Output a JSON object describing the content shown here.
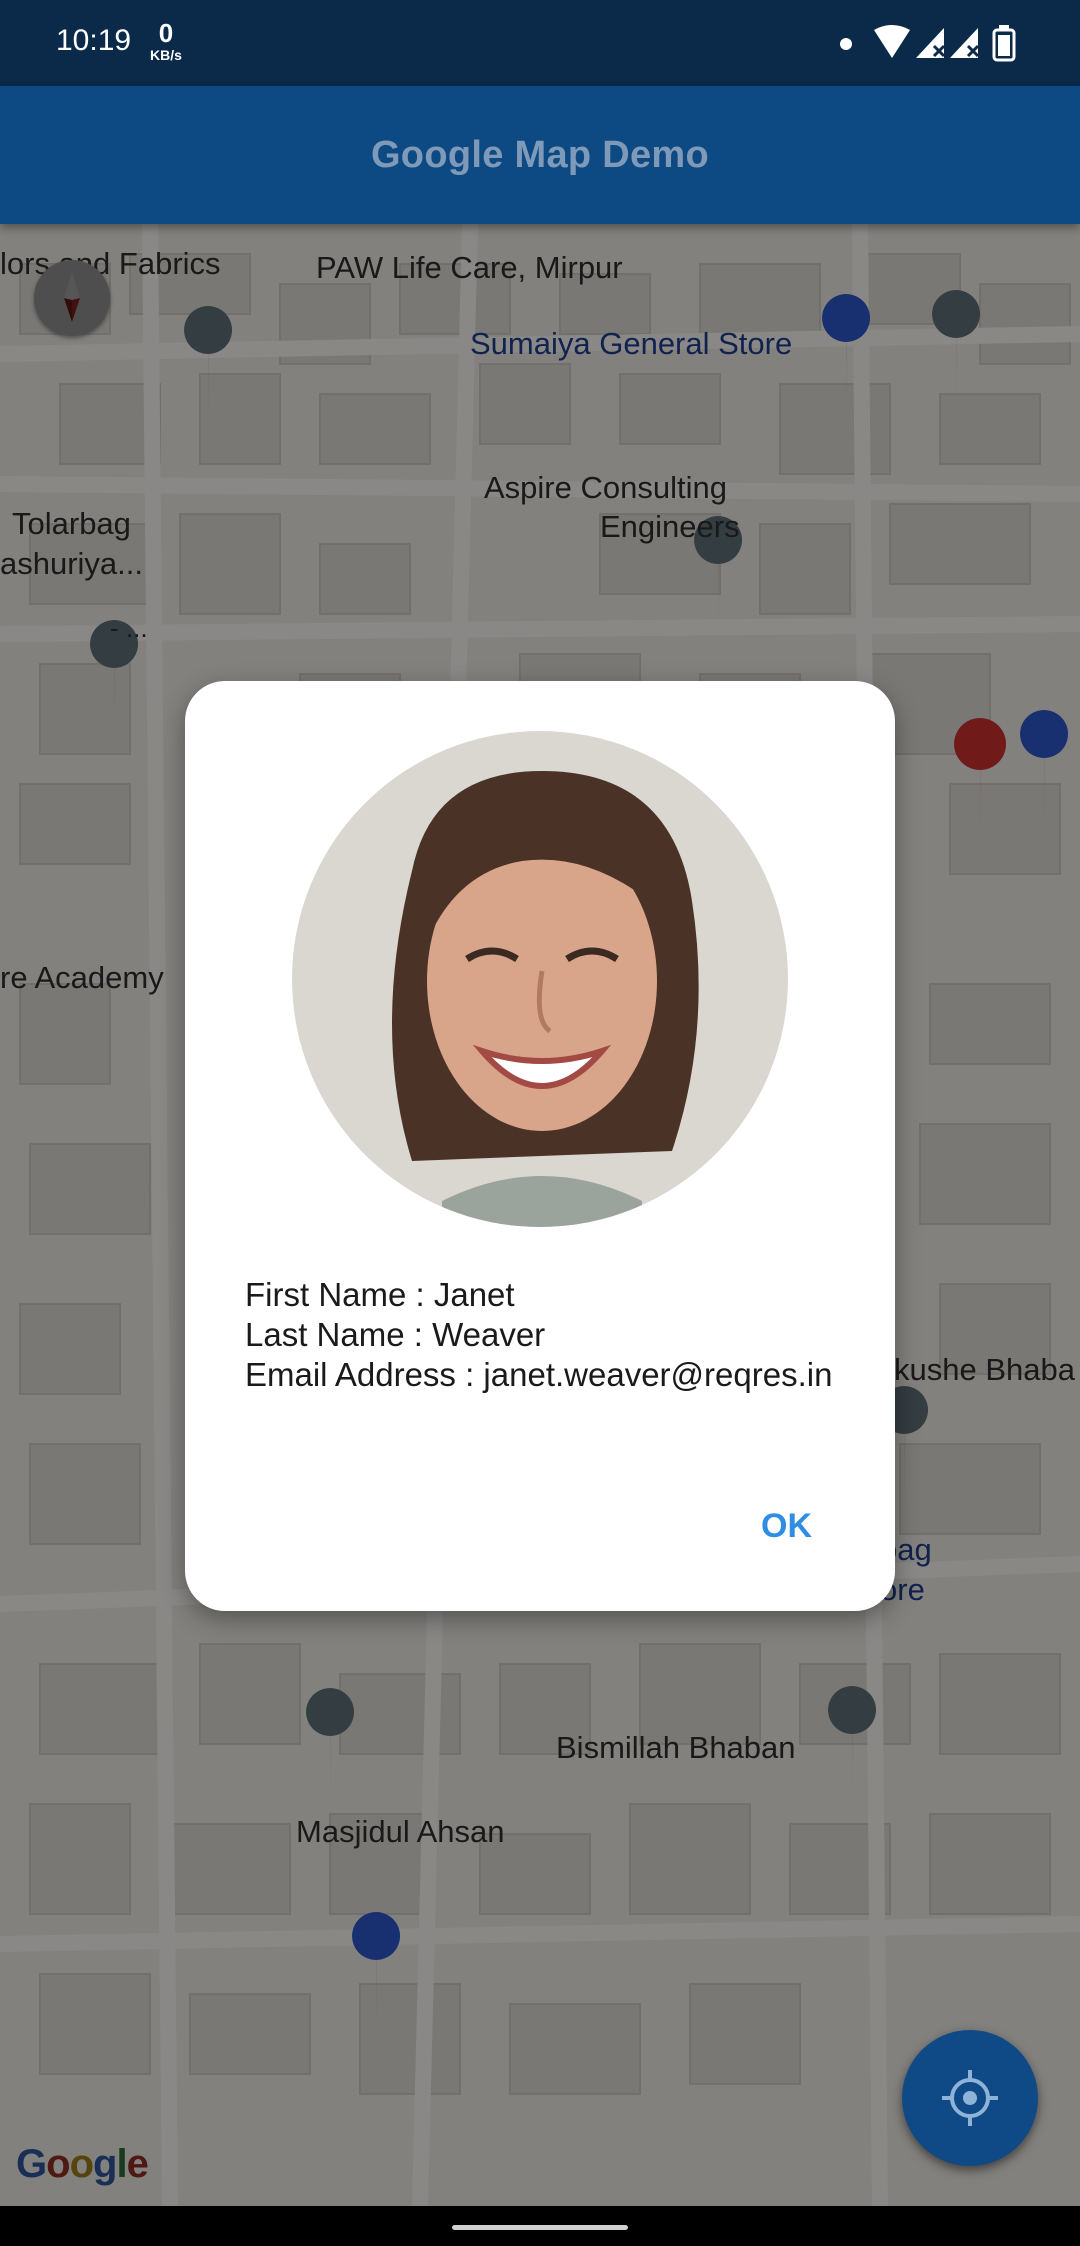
{
  "status_bar": {
    "time": "10:19",
    "net_speed_value": "0",
    "net_speed_unit": "KB/s"
  },
  "app_bar": {
    "title": "Google Map Demo"
  },
  "map": {
    "labels": {
      "fabrics": "lors and Fabrics",
      "paw": "PAW Life Care, Mirpur",
      "sumaiya": "Sumaiya General Store",
      "aspire_1": "Aspire Consulting",
      "aspire_2": "Engineers",
      "tolarbag_1": "Tolarbag",
      "tolarbag_2": "ashuriya...",
      "dash": "- ...",
      "academy": "re Academy",
      "kushe": "kushe Bhaba",
      "bag_1": "bag",
      "bag_2": "ore",
      "bismillah": "Bismillah Bhaban",
      "masjid": "Masjidul Ahsan"
    },
    "logo_letters": [
      "G",
      "o",
      "o",
      "g",
      "l",
      "e"
    ]
  },
  "dialog": {
    "first_name": "First Name : Janet",
    "last_name": "Last Name : Weaver",
    "email": "Email Address : janet.weaver@reqres.in",
    "ok_label": "OK"
  },
  "colors": {
    "app_bar": "#0d4a84",
    "status_bar": "#0b2a4a",
    "accent": "#2f8de4",
    "dialog_bg": "#ffffff"
  },
  "icons": {
    "compass": "compass-icon",
    "my_location": "my-location-icon",
    "wifi": "wifi-icon",
    "signal": "signal-icon",
    "battery": "battery-icon"
  }
}
